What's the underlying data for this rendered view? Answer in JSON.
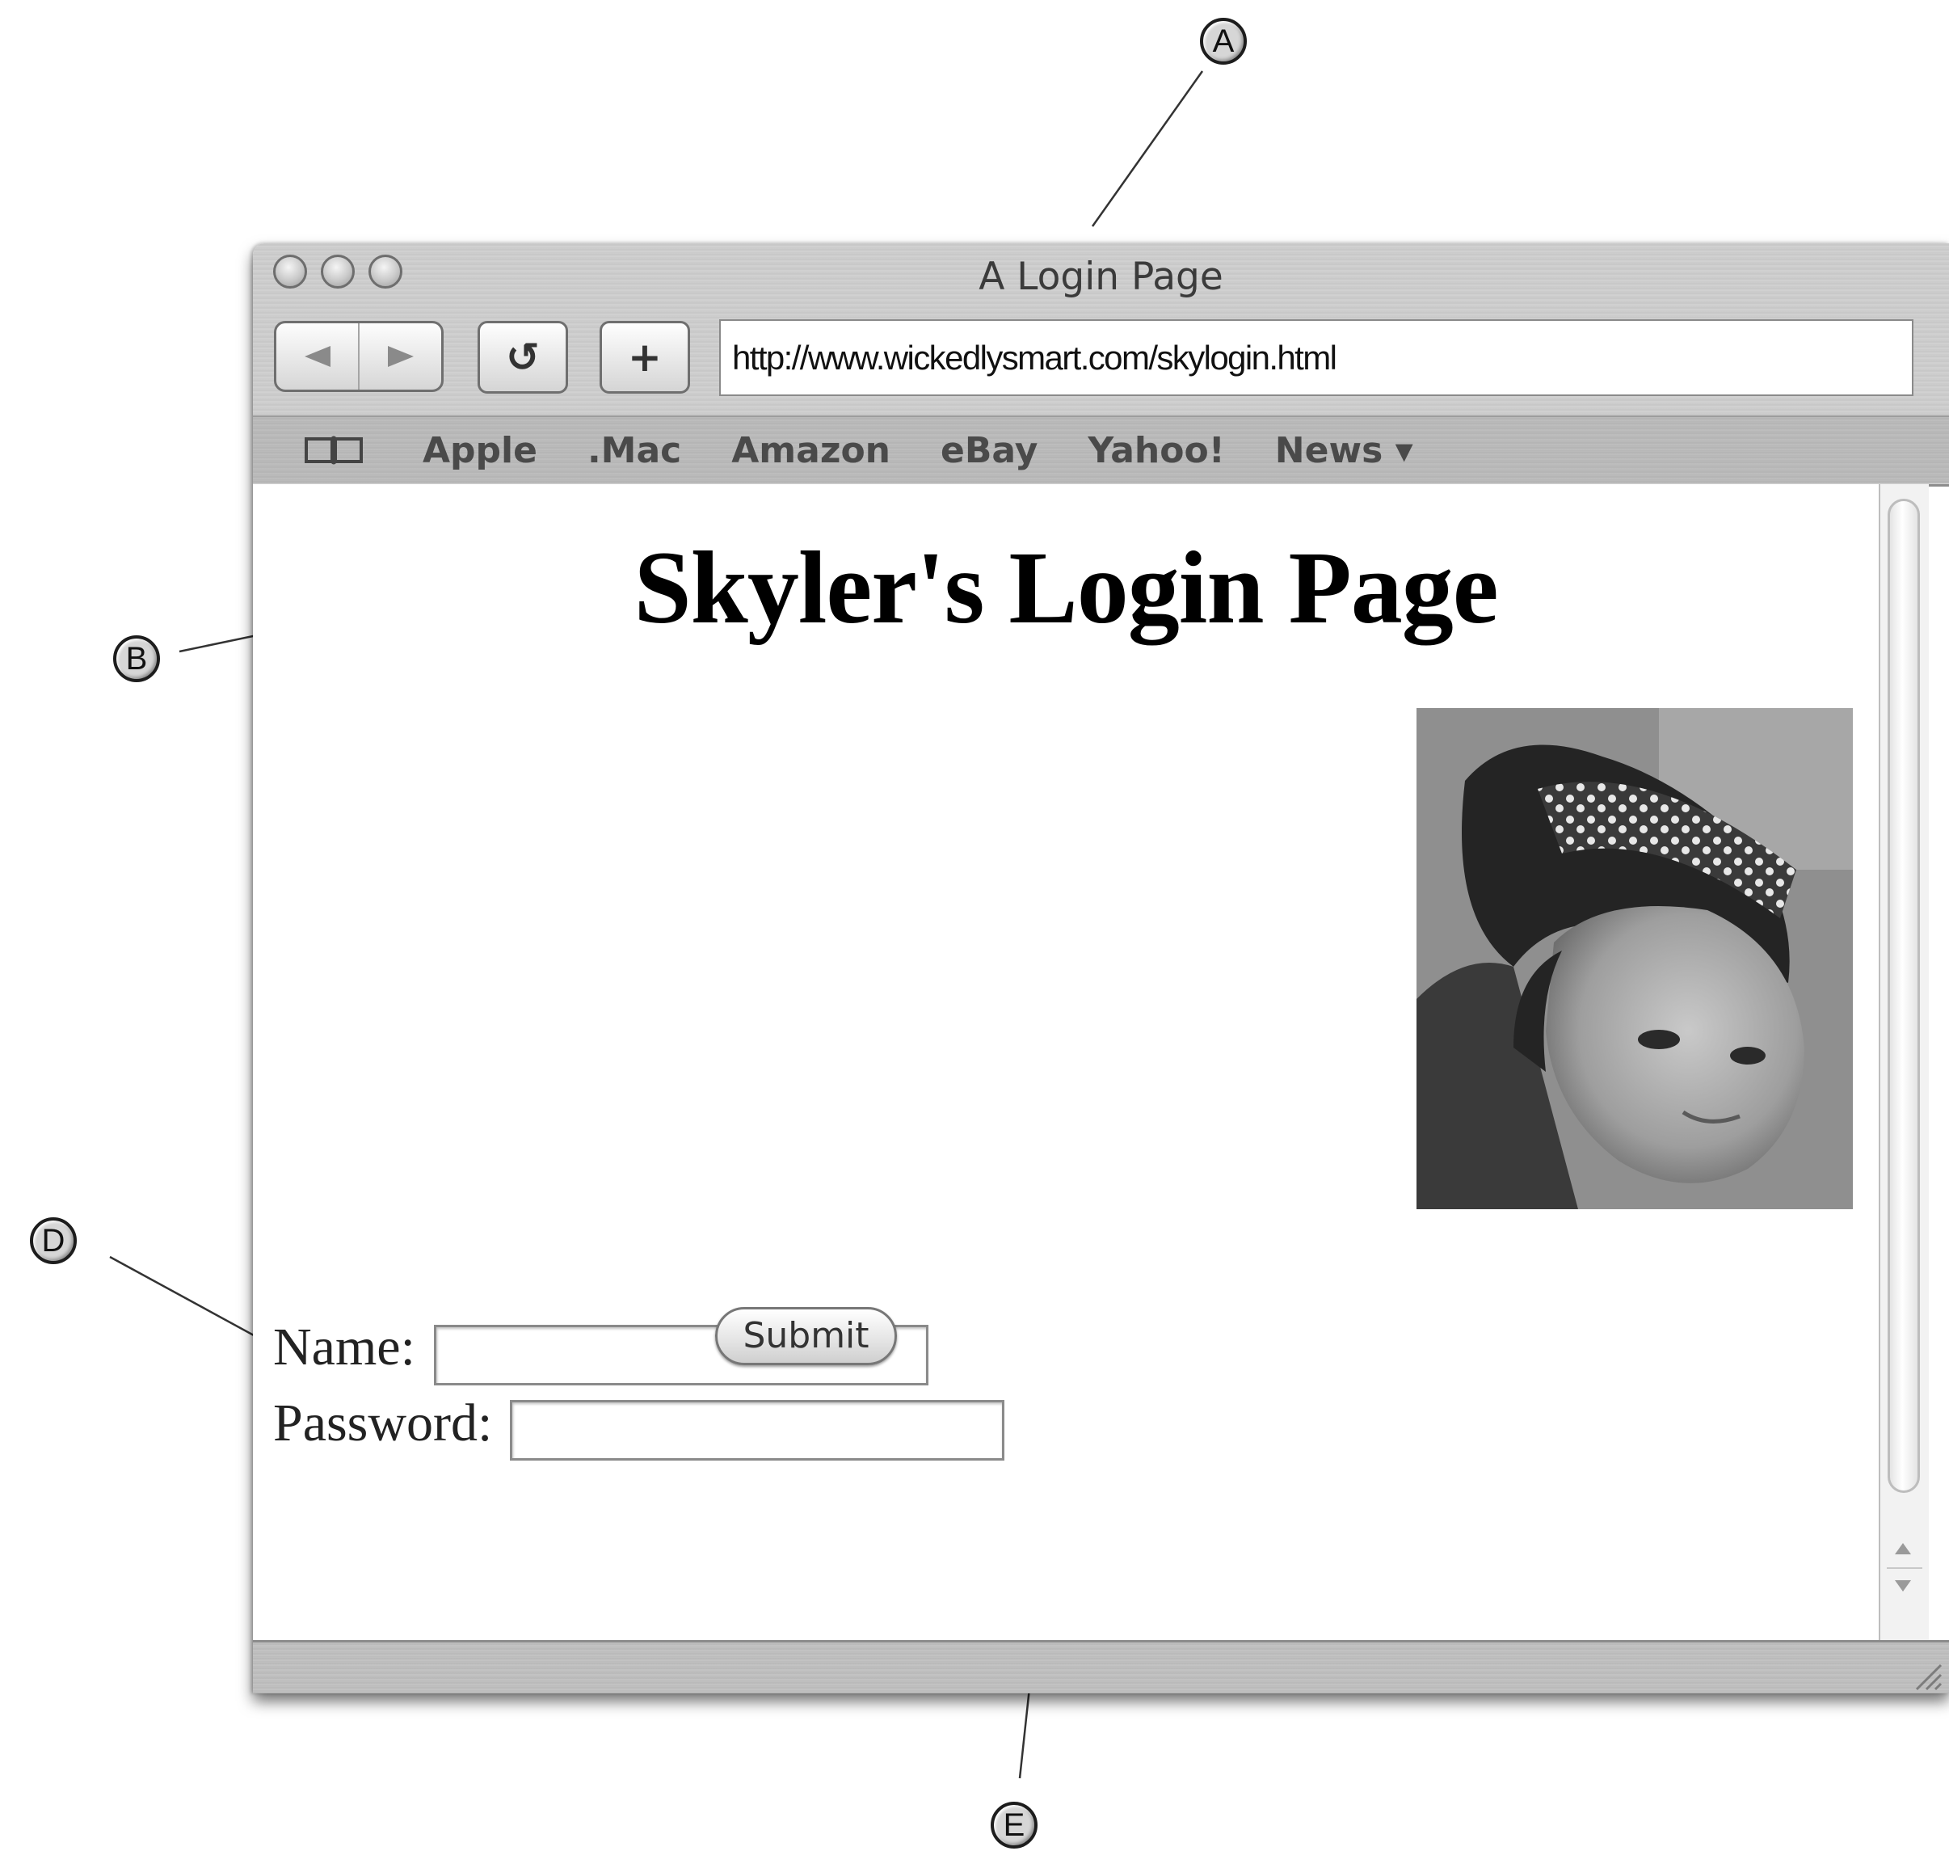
{
  "callouts": {
    "a": "A",
    "b": "B",
    "d": "D",
    "e": "E"
  },
  "window": {
    "title": "A Login Page"
  },
  "toolbar": {
    "back_icon": "back-arrow-icon",
    "forward_icon": "forward-arrow-icon",
    "reload_glyph": "↺",
    "add_glyph": "+",
    "url": "http://www.wickedlysmart.com/skylogin.html"
  },
  "bookmarks": {
    "icon": "bookmarks-book-icon",
    "items": [
      "Apple",
      ".Mac",
      "Amazon",
      "eBay",
      "Yahoo!",
      "News ▾"
    ]
  },
  "page": {
    "title": "Skyler's Login Page",
    "photo_description_icon": "photo-of-skyler",
    "name_label": "Name:",
    "name_value": "",
    "password_label": "Password:",
    "password_value": "",
    "submit_label": "Submit"
  }
}
